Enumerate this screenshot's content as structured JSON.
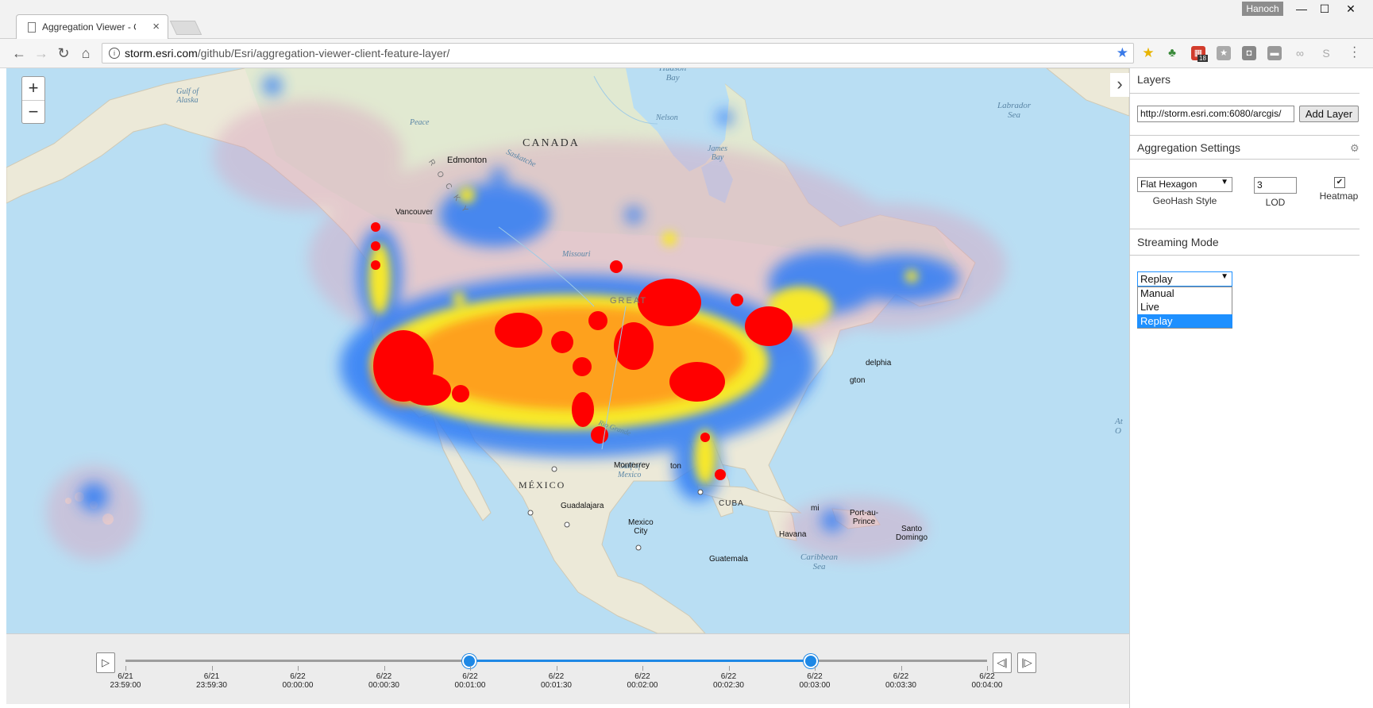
{
  "browser": {
    "tab_title": "Aggregation Viewer - Cli",
    "tab_close": "×",
    "user": "Hanoch",
    "window_controls": {
      "minimize": "—",
      "maximize": "☐",
      "close": "✕"
    },
    "nav": {
      "back": "←",
      "forward": "→",
      "reload": "↻",
      "home": "⌂"
    },
    "url_host": "storm.esri.com",
    "url_path": "/github/Esri/aggregation-viewer-client-feature-layer/",
    "extension_badge": "18",
    "icons": [
      "star-bookmark-icon",
      "extension-yellow-star-icon",
      "extension-green-icon",
      "extension-calendar-icon",
      "extension-gray-star-icon",
      "extension-pocket-icon",
      "extension-cast-icon",
      "extension-link-icon",
      "extension-skype-icon",
      "menu-icon"
    ]
  },
  "map": {
    "zoom_in": "+",
    "zoom_out": "−",
    "collapse": "›",
    "labels": {
      "canada": "CANADA",
      "mexico": "MÉXICO",
      "cuba": "CUBA",
      "hudson_bay": "Hudson\nBay",
      "james_bay": "James\nBay",
      "labrador_sea": "Labrador\nSea",
      "gulf_alaska": "Gulf of\nAlaska",
      "gulf_mexico": "Gulf of\nMexico",
      "caribbean": "Caribbean\nSea",
      "edmonton": "Edmonton",
      "vancouver": "Vancouver",
      "monterrey": "Monterrey",
      "guadalajara": "Guadalajara",
      "mexico_city": "Mexico\nCity",
      "havana": "Havana",
      "guatemala": "Guatemala",
      "port_au_prince": "Port-au-\nPrince",
      "santo_domingo": "Santo\nDomingo",
      "philadelphia": "delphia",
      "washington": "gton",
      "houston": "ton",
      "miami": "mi",
      "missouri": "Missouri",
      "nelson": "Nelson",
      "peace": "Peace",
      "great_plains": "GREAT",
      "atlantic": "At\nO",
      "rocky": "R O C K Y",
      "saskatchewan": "Saskatche",
      "rio_grande": "Rio Grande"
    }
  },
  "timeline": {
    "play": "▷",
    "step_back": "◁|",
    "step_forward": "|▷",
    "ticks": [
      {
        "date": "6/21",
        "time": "23:59:00"
      },
      {
        "date": "6/21",
        "time": "23:59:30"
      },
      {
        "date": "6/22",
        "time": "00:00:00"
      },
      {
        "date": "6/22",
        "time": "00:00:30"
      },
      {
        "date": "6/22",
        "time": "00:01:00"
      },
      {
        "date": "6/22",
        "time": "00:01:30"
      },
      {
        "date": "6/22",
        "time": "00:02:00"
      },
      {
        "date": "6/22",
        "time": "00:02:30"
      },
      {
        "date": "6/22",
        "time": "00:03:00"
      },
      {
        "date": "6/22",
        "time": "00:03:30"
      },
      {
        "date": "6/22",
        "time": "00:04:00"
      }
    ],
    "range_start": "00:01:00",
    "range_end": "00:03:00"
  },
  "panel": {
    "layers_header": "Layers",
    "layer_url": "http://storm.esri.com:6080/arcgis/",
    "add_layer": "Add Layer",
    "aggregation_header": "Aggregation Settings",
    "geohash_style_value": "Flat Hexagon",
    "geohash_style_label": "GeoHash Style",
    "lod_value": "3",
    "lod_label": "LOD",
    "heatmap_label": "Heatmap",
    "heatmap_checked": true,
    "streaming_header": "Streaming Mode",
    "streaming_value": "Replay",
    "streaming_options": [
      "Manual",
      "Live",
      "Replay"
    ],
    "streaming_selected": "Replay",
    "select_accent": "#1e90ff"
  }
}
